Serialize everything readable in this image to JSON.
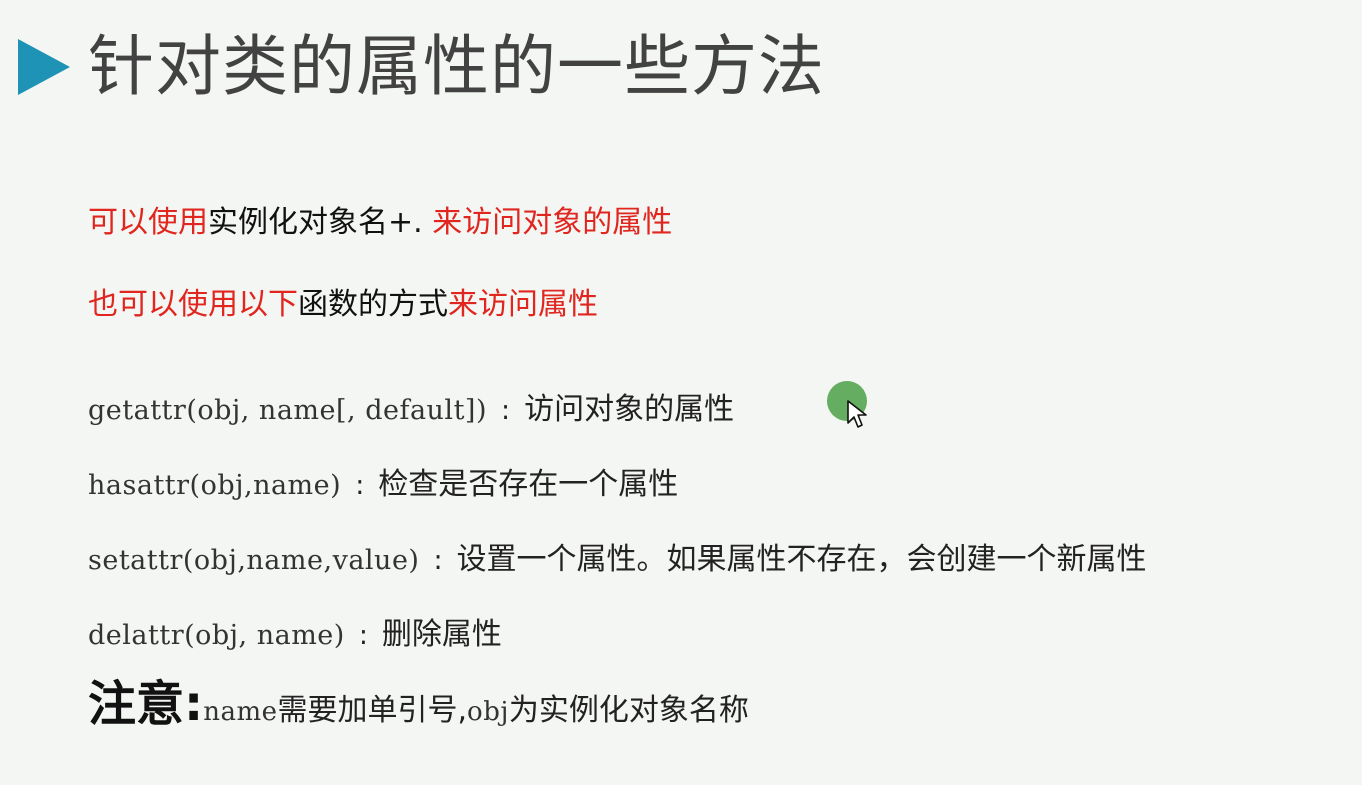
{
  "title": "针对类的属性的一些方法",
  "intro": {
    "line1": {
      "part1": "可以使用",
      "part2": "实例化对象名+. ",
      "part3": "来访问对象的属性"
    },
    "line2": {
      "part1": "也可以使用以下",
      "part2": "函数的方式",
      "part3": "来访问属性"
    }
  },
  "functions": [
    {
      "code": "getattr(obj, name[, default])",
      "sep": ":",
      "desc": "访问对象的属性"
    },
    {
      "code": "hasattr(obj,name)",
      "sep": ":",
      "desc": "检查是否存在一个属性"
    },
    {
      "code": "setattr(obj,name,value)",
      "sep": ":",
      "desc": "设置一个属性。如果属性不存在，会创建一个新属性"
    },
    {
      "code": "delattr(obj, name)",
      "sep": ":",
      "desc": "删除属性"
    }
  ],
  "note": {
    "head": "注意:",
    "code1": "name",
    "text1": "需要加单引号,",
    "code2": "obj",
    "text2": "为实例化对象名称"
  },
  "colors": {
    "accent_triangle": "#1f93b5",
    "highlight_red": "#e0261f",
    "cursor_green": "#4aa046"
  },
  "icons": {
    "title_marker": "triangle-right-icon",
    "cursor": "mouse-pointer-icon"
  }
}
